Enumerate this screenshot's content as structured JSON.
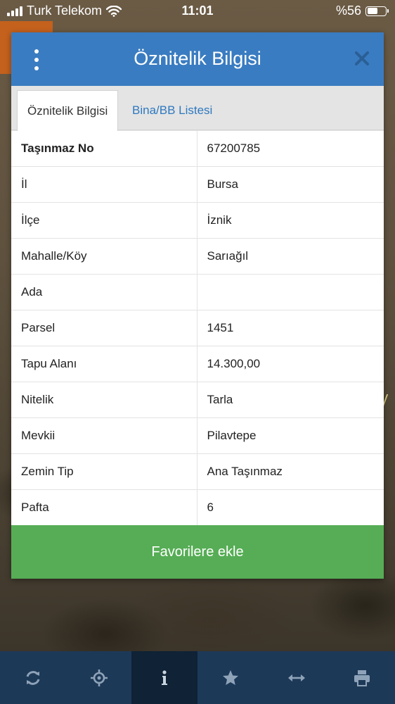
{
  "status_bar": {
    "carrier": "Turk Telekom",
    "time": "11:01",
    "battery": "%56"
  },
  "dialog": {
    "title": "Öznitelik Bilgisi",
    "tabs": [
      {
        "label": "Öznitelik Bilgisi",
        "active": true
      },
      {
        "label": "Bina/BB Listesi",
        "active": false
      }
    ],
    "rows": [
      {
        "label": "Taşınmaz No",
        "value": "67200785"
      },
      {
        "label": "İl",
        "value": "Bursa"
      },
      {
        "label": "İlçe",
        "value": "İznik"
      },
      {
        "label": "Mahalle/Köy",
        "value": "Sarıağıl"
      },
      {
        "label": "Ada",
        "value": ""
      },
      {
        "label": "Parsel",
        "value": "1451"
      },
      {
        "label": "Tapu Alanı",
        "value": "14.300,00"
      },
      {
        "label": "Nitelik",
        "value": "Tarla"
      },
      {
        "label": "Mevkii",
        "value": "Pilavtepe"
      },
      {
        "label": "Zemin Tip",
        "value": "Ana Taşınmaz"
      },
      {
        "label": "Pafta",
        "value": "6"
      }
    ],
    "favorite_button": "Favorilere ekle"
  },
  "toolbar": {
    "items": [
      {
        "icon": "refresh-icon",
        "active": false
      },
      {
        "icon": "locate-icon",
        "active": false
      },
      {
        "icon": "info-icon",
        "active": true
      },
      {
        "icon": "star-icon",
        "active": false
      },
      {
        "icon": "measure-icon",
        "active": false
      },
      {
        "icon": "print-icon",
        "active": false
      }
    ]
  },
  "colors": {
    "header": "#3a7cc1",
    "favorite_button": "#56ad55",
    "toolbar": "#1d3958",
    "tab_link": "#2f79bf"
  }
}
